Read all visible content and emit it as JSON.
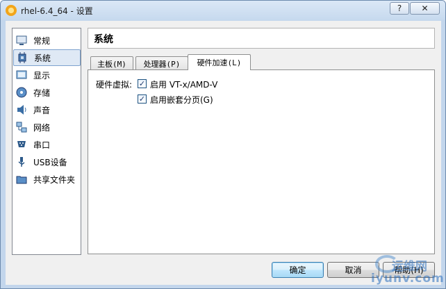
{
  "window": {
    "title": "rhel-6.4_64 - 设置",
    "help_glyph": "?",
    "close_glyph": "✕"
  },
  "sidebar": {
    "items": [
      {
        "label": "常规",
        "icon": "monitor-general-icon"
      },
      {
        "label": "系统",
        "icon": "chip-system-icon",
        "selected": true
      },
      {
        "label": "显示",
        "icon": "display-icon"
      },
      {
        "label": "存储",
        "icon": "disk-storage-icon"
      },
      {
        "label": "声音",
        "icon": "speaker-icon"
      },
      {
        "label": "网络",
        "icon": "network-icon"
      },
      {
        "label": "串口",
        "icon": "serial-port-icon"
      },
      {
        "label": "USB设备",
        "icon": "usb-icon"
      },
      {
        "label": "共享文件夹",
        "icon": "shared-folder-icon"
      }
    ]
  },
  "header": {
    "title": "系统"
  },
  "tabs": [
    {
      "label": "主板(M)"
    },
    {
      "label": "处理器(P)"
    },
    {
      "label": "硬件加速(L)",
      "active": true
    }
  ],
  "panel": {
    "field_label": "硬件虚拟:",
    "options": [
      {
        "label": "启用 VT-x/AMD-V",
        "checked": true,
        "check_glyph": "✓"
      },
      {
        "label": "启用嵌套分页(G)",
        "checked": true,
        "check_glyph": "✓"
      }
    ]
  },
  "buttons": {
    "ok": "确定",
    "cancel": "取消",
    "help": "帮助(H)"
  },
  "watermark": {
    "line1": "运维网",
    "line2": "iyunv.com"
  },
  "colors": {
    "title_bg": "#c6d9ee",
    "selected_bg": "#dfe9f5",
    "default_button_border": "#3c7fb1"
  }
}
